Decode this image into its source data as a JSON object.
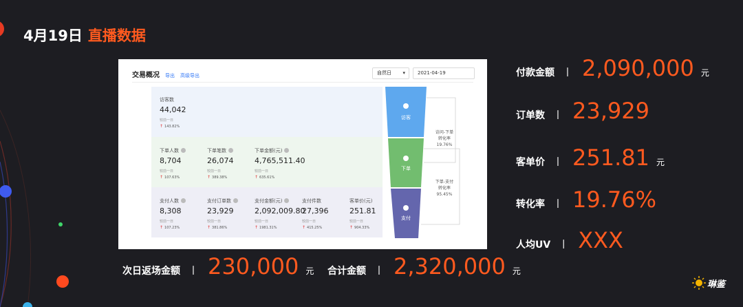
{
  "slide": {
    "date": "4月19日",
    "topic": "直播数据"
  },
  "panel": {
    "title": "交易概况",
    "export_label": "导出",
    "advanced_export_label": "高级导出",
    "period_select": "自然日",
    "date_value": "2021-04-19",
    "compare_label": "较前一日",
    "sections": [
      {
        "metrics": [
          {
            "label": "访客数",
            "value": "44,042",
            "change": "143.82%"
          }
        ]
      },
      {
        "metrics": [
          {
            "label": "下单人数",
            "value": "8,704",
            "change": "107.63%"
          },
          {
            "label": "下单笔数",
            "value": "26,074",
            "change": "389.38%"
          },
          {
            "label": "下单金额(元)",
            "value": "4,765,511.40",
            "change": "635.61%"
          }
        ]
      },
      {
        "metrics": [
          {
            "label": "支付人数",
            "value": "8,308",
            "change": "107.23%"
          },
          {
            "label": "支付订单数",
            "value": "23,929",
            "change": "381.86%"
          },
          {
            "label": "支付金额(元)",
            "value": "2,092,009.80",
            "change": "1981.31%"
          },
          {
            "label": "支付件数",
            "value": "27,396",
            "change": "415.25%"
          },
          {
            "label": "客单价(元)",
            "value": "251.81",
            "change": "904.33%"
          }
        ]
      }
    ],
    "funnel": {
      "stages": [
        {
          "label": "访客",
          "color": "#5ea8ee"
        },
        {
          "label": "下单",
          "color": "#72bd6f"
        },
        {
          "label": "支付",
          "color": "#6466ad"
        }
      ],
      "conversions": [
        {
          "line1": "访问-下单",
          "line2": "转化率",
          "value": "19.76%"
        },
        {
          "line1": "下单-支付",
          "line2": "转化率",
          "value": "95.45%"
        }
      ]
    }
  },
  "stats": [
    {
      "label": "付款金额",
      "value": "2,090,000",
      "unit": "元"
    },
    {
      "label": "订单数",
      "value": "23,929",
      "unit": ""
    },
    {
      "label": "客单价",
      "value": "251.81",
      "unit": "元"
    },
    {
      "label": "转化率",
      "value": "19.76%",
      "unit": ""
    },
    {
      "label": "人均UV",
      "value": "XXX",
      "unit": ""
    }
  ],
  "bottom_stats": [
    {
      "label": "次日返场金额",
      "value": "230,000",
      "unit": "元"
    },
    {
      "label": "合计金额",
      "value": "2,320,000",
      "unit": "元"
    }
  ],
  "separator": "丨",
  "logo_text": "琳鉴",
  "colors": {
    "accent": "#ff5a1f",
    "background": "#1d1d22"
  }
}
